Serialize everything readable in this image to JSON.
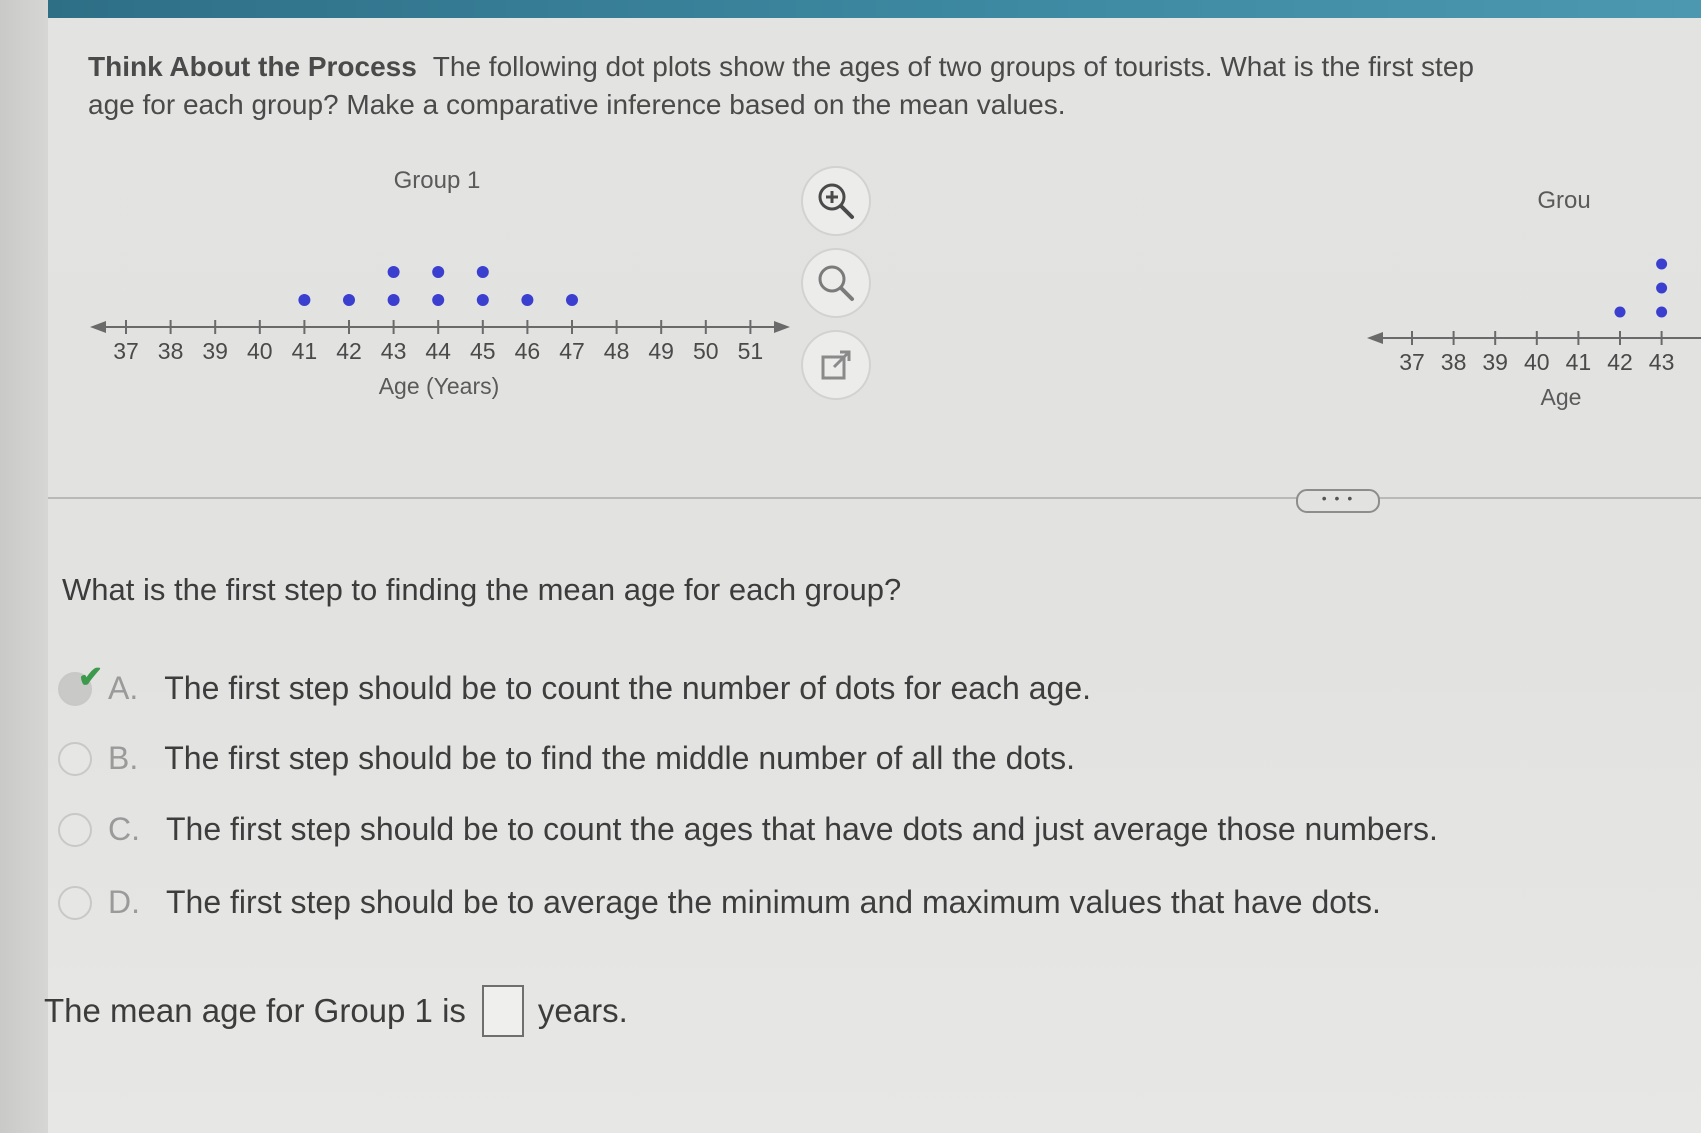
{
  "intro": {
    "heading": "Think About the Process",
    "text_line1": "The following dot plots show the ages of two groups of tourists. What is the first step",
    "text_line2": "age for each group? Make a comparative inference based on the mean values."
  },
  "chart_data": [
    {
      "type": "scatter",
      "title": "Group 1",
      "xlabel": "Age (Years)",
      "xlim": [
        37,
        51
      ],
      "x_ticks": [
        37,
        38,
        39,
        40,
        41,
        42,
        43,
        44,
        45,
        46,
        47,
        48,
        49,
        50,
        51
      ],
      "points": [
        {
          "x": 41,
          "count": 1
        },
        {
          "x": 42,
          "count": 1
        },
        {
          "x": 43,
          "count": 2
        },
        {
          "x": 44,
          "count": 2
        },
        {
          "x": 45,
          "count": 2
        },
        {
          "x": 46,
          "count": 1
        },
        {
          "x": 47,
          "count": 1
        }
      ]
    },
    {
      "type": "scatter",
      "title": "Grou",
      "xlabel": "Age",
      "x_ticks": [
        37,
        38,
        39,
        40,
        41,
        42,
        43
      ],
      "points": [
        {
          "x": 42,
          "count": 1
        },
        {
          "x": 43,
          "count": 3
        }
      ]
    }
  ],
  "tools": {
    "zoom_in": "zoom-in-icon",
    "zoom": "magnifier-icon",
    "popout": "external-link-icon"
  },
  "divider": {
    "more_label": "• • •"
  },
  "question": "What is the first step to finding the mean age for each group?",
  "options": [
    {
      "letter": "A.",
      "text": "The first step should be to count the number of dots for each age.",
      "selected": true
    },
    {
      "letter": "B.",
      "text": "The first step should be to find the middle number of all the dots.",
      "selected": false
    },
    {
      "letter": "C.",
      "text": "The first step should be to count the ages that have dots and just average those numbers.",
      "selected": false
    },
    {
      "letter": "D.",
      "text": "The first step should be to average the minimum and maximum values that have dots.",
      "selected": false
    }
  ],
  "mean_sentence": {
    "before": "The mean age for Group 1 is",
    "after": "years."
  },
  "colors": {
    "dot": "#3b3fd0",
    "accent_bar": "#2e6f86",
    "check": "#3c9a4c"
  }
}
